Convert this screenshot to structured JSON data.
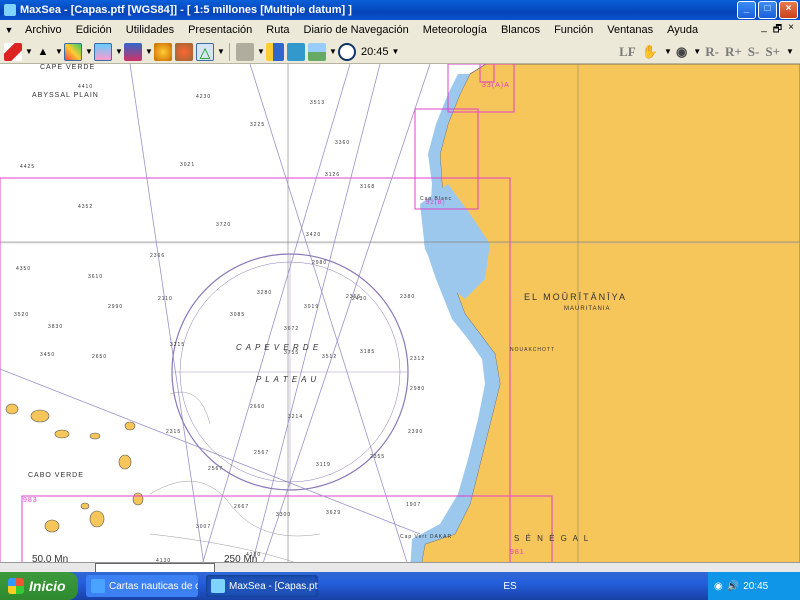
{
  "window": {
    "title": "MaxSea - [Capas.ptf [WGS84]] - [ 1:5 millones  [Multiple datum] ]"
  },
  "window_controls": {
    "minimize": "_",
    "maximize": "□",
    "close": "×"
  },
  "menu": {
    "items": [
      "Archivo",
      "Edición",
      "Utilidades",
      "Presentación",
      "Ruta",
      "Diario de Navegación",
      "Meteorología",
      "Blancos",
      "Función",
      "Ventanas",
      "Ayuda"
    ],
    "mdi_controls": [
      "_",
      "🗗",
      "×"
    ]
  },
  "toolbar": {
    "time": "20:45",
    "right_tools": [
      "LF",
      "R-",
      "R+",
      "S-",
      "S+"
    ]
  },
  "map": {
    "labels": {
      "cape_verde_top": "CAPE VERDE",
      "abyssal_plain": "ABYSSAL PLAIN",
      "plateau_1": "C A P E   V E R D E",
      "plateau_2": "P L A T E A U",
      "el_mauritaniya": "EL   MOŪRĪTĀNĪYA",
      "mauritania": "MAURITANIA",
      "cabo_verde": "CABO VERDE",
      "senegal": "S É N É G A L",
      "nouakchott": "NOUAKCHOTT",
      "cap_blanc": "Cap Blanc",
      "dakar": "Cap Vert DAKAR",
      "chart_983": "983",
      "chart_981": "981",
      "chart_top": "33(A)A",
      "chart_mid": "52(B)"
    },
    "scale_bar": {
      "left": "50.0 Mn",
      "right": "250 Mn"
    },
    "depths": [
      "4410",
      "4230",
      "3513",
      "3225",
      "3126",
      "4350",
      "3830",
      "2990",
      "3420",
      "2366",
      "2110",
      "3019",
      "3280",
      "2355",
      "3360",
      "4425",
      "4352",
      "3720",
      "3085",
      "2380",
      "2312",
      "2650",
      "3610",
      "3215",
      "3520",
      "3672",
      "3755",
      "3512",
      "3185",
      "3450",
      "2980",
      "2315",
      "2660",
      "2567",
      "3214",
      "2567",
      "2355",
      "2390",
      "3119",
      "1907",
      "2667",
      "3300",
      "3007",
      "3629",
      "4130",
      "4180",
      "3021",
      "2430",
      "3168",
      "2980"
    ]
  },
  "taskbar": {
    "start_label": "Inicio",
    "tasks": [
      "Cartas nauticas de ca...",
      "MaxSea - [Capas.ptf ..."
    ],
    "language": "ES",
    "clock": "20:45"
  }
}
